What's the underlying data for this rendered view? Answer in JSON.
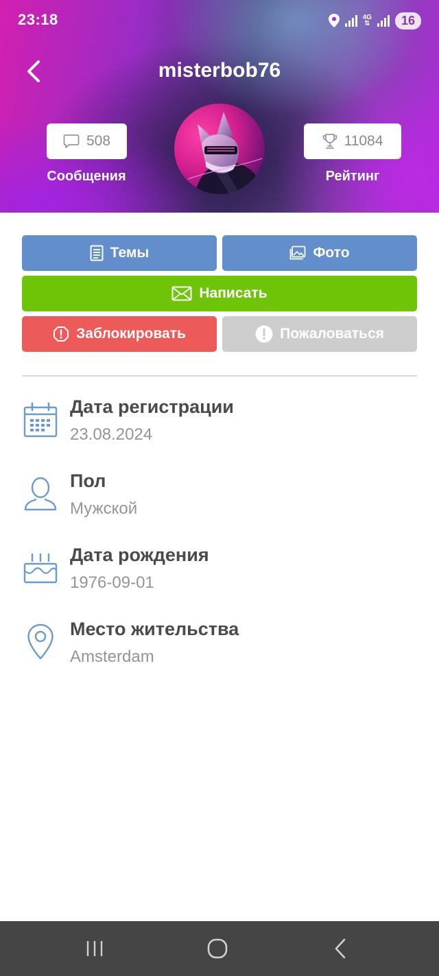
{
  "status_bar": {
    "time": "23:18",
    "network": "4G",
    "battery": "16"
  },
  "profile": {
    "username": "misterbob76",
    "messages_count": "508",
    "messages_label": "Сообщения",
    "rating_value": "11084",
    "rating_label": "Рейтинг"
  },
  "actions": {
    "topics_label": "Темы",
    "photo_label": "Фото",
    "write_label": "Написать",
    "block_label": "Заблокировать",
    "report_label": "Пожаловаться"
  },
  "info": [
    {
      "icon": "calendar-icon",
      "title": "Дата регистрации",
      "value": "23.08.2024"
    },
    {
      "icon": "person-icon",
      "title": "Пол",
      "value": "Мужской"
    },
    {
      "icon": "birthday-cake-icon",
      "title": "Дата рождения",
      "value": "1976-09-01"
    },
    {
      "icon": "location-pin-icon",
      "title": "Место жительства",
      "value": "Amsterdam"
    }
  ],
  "colors": {
    "button_blue": "#628fcb",
    "button_green": "#6ec407",
    "button_red": "#ec5a5a",
    "button_gray": "#cdcdcd",
    "icon_blue": "#6a9ad0",
    "nav_bar": "#454545"
  }
}
